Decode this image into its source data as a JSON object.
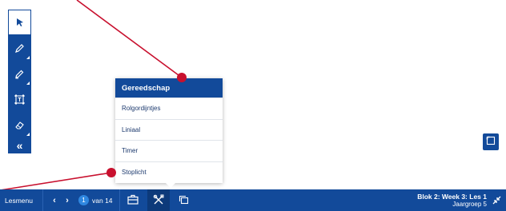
{
  "toolbar": {
    "collapse_glyph": "«",
    "tools": [
      {
        "icon": "cursor-arrow-icon"
      },
      {
        "icon": "pencil-icon"
      },
      {
        "icon": "marker-icon"
      },
      {
        "icon": "text-frame-icon"
      },
      {
        "icon": "eraser-icon"
      }
    ]
  },
  "popup": {
    "title": "Gereedschap",
    "items": [
      "Rolgordijntjes",
      "Liniaal",
      "Timer",
      "Stoplicht"
    ]
  },
  "bottombar": {
    "lesmenu": "Lesmenu",
    "prev": "‹",
    "next": "›",
    "page_current": "1",
    "page_total": "van 14",
    "lesson_title": "Blok 2: Week 3: Les 1",
    "lesson_subtitle": "Jaargroep 5"
  },
  "colors": {
    "brand_blue": "#124a9a",
    "annotation_red": "#c8102e"
  }
}
